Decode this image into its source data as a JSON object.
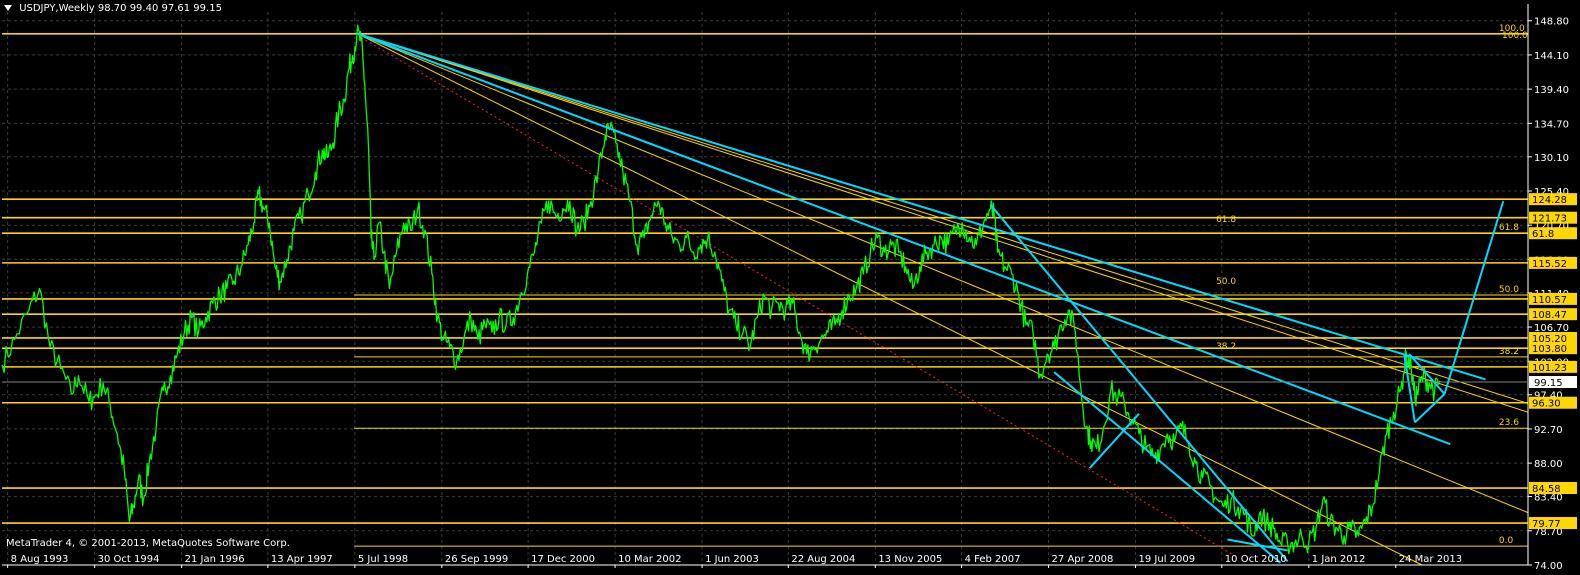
{
  "header": {
    "symbol_text": "USDJPY,Weekly",
    "ohlc_text": "98.70 99.40 97.61 99.15"
  },
  "footer": {
    "copyright": "MetaTrader 4, © 2001-2013, MetaQuotes Software Corp."
  },
  "colors": {
    "background": "#000000",
    "grid": "#3a3a3a",
    "price_line": "#00ff00",
    "level_line": "#ffd700",
    "trend_cyan": "#00d8ff",
    "dotted_red": "#ff2020",
    "axis_text": "#ffffff"
  },
  "chart_data": {
    "type": "line",
    "instrument": "USDJPY",
    "timeframe": "Weekly",
    "current_price": 99.15,
    "ylim": [
      74.0,
      150.0
    ],
    "y_tick_labels": [
      "148.80",
      "144.10",
      "139.40",
      "134.70",
      "130.10",
      "125.40",
      "120.70",
      "116.00",
      "111.40",
      "106.70",
      "102.00",
      "97.40",
      "92.70",
      "88.00",
      "83.40",
      "78.70",
      "74.00"
    ],
    "y_tick_values": [
      148.8,
      144.1,
      139.4,
      134.7,
      130.1,
      125.4,
      120.7,
      116.0,
      111.4,
      106.7,
      102.0,
      97.4,
      92.7,
      88.0,
      83.4,
      78.7,
      74.0
    ],
    "x_tick_labels": [
      "8 Aug 1993",
      "30 Oct 1994",
      "21 Jan 1996",
      "13 Apr 1997",
      "5 Jul 1998",
      "26 Sep 1999",
      "17 Dec 2000",
      "10 Mar 2002",
      "1 Jun 2003",
      "22 Aug 2004",
      "13 Nov 2005",
      "4 Feb 2007",
      "27 Apr 2008",
      "19 Jul 2009",
      "10 Oct 2010",
      "1 Jan 2012",
      "24 Mar 2013"
    ],
    "x_tick_values": [
      1993.6,
      1994.83,
      1996.06,
      1997.28,
      1998.51,
      1999.74,
      2000.96,
      2002.19,
      2003.42,
      2004.64,
      2005.87,
      2007.09,
      2008.32,
      2009.55,
      2010.77,
      2012.0,
      2013.23
    ],
    "xlim": [
      1993.52,
      2015.1
    ],
    "price_series": [
      [
        1993.52,
        101.5
      ],
      [
        1993.7,
        105
      ],
      [
        1993.9,
        109
      ],
      [
        1994.05,
        112
      ],
      [
        1994.2,
        104
      ],
      [
        1994.35,
        101
      ],
      [
        1994.5,
        97.5
      ],
      [
        1994.6,
        100
      ],
      [
        1994.75,
        96.5
      ],
      [
        1994.82,
        97
      ],
      [
        1994.95,
        99
      ],
      [
        1995.05,
        96
      ],
      [
        1995.15,
        92
      ],
      [
        1995.25,
        87
      ],
      [
        1995.32,
        80
      ],
      [
        1995.38,
        82
      ],
      [
        1995.45,
        86
      ],
      [
        1995.52,
        83
      ],
      [
        1995.6,
        88
      ],
      [
        1995.7,
        93
      ],
      [
        1995.8,
        98
      ],
      [
        1995.9,
        100
      ],
      [
        1996.0,
        103
      ],
      [
        1996.1,
        106
      ],
      [
        1996.2,
        108
      ],
      [
        1996.3,
        106
      ],
      [
        1996.4,
        108
      ],
      [
        1996.5,
        110
      ],
      [
        1996.6,
        111
      ],
      [
        1996.7,
        112
      ],
      [
        1996.8,
        113
      ],
      [
        1996.9,
        115
      ],
      [
        1997.0,
        118
      ],
      [
        1997.08,
        121
      ],
      [
        1997.15,
        125
      ],
      [
        1997.22,
        123
      ],
      [
        1997.3,
        121
      ],
      [
        1997.38,
        115
      ],
      [
        1997.45,
        113
      ],
      [
        1997.55,
        116
      ],
      [
        1997.65,
        120
      ],
      [
        1997.75,
        122
      ],
      [
        1997.85,
        125
      ],
      [
        1997.95,
        128
      ],
      [
        1998.05,
        131
      ],
      [
        1998.12,
        130
      ],
      [
        1998.2,
        132
      ],
      [
        1998.28,
        136
      ],
      [
        1998.36,
        138
      ],
      [
        1998.42,
        142
      ],
      [
        1998.48,
        144
      ],
      [
        1998.54,
        147
      ],
      [
        1998.6,
        146
      ],
      [
        1998.65,
        140
      ],
      [
        1998.7,
        132
      ],
      [
        1998.74,
        119
      ],
      [
        1998.78,
        116
      ],
      [
        1998.85,
        121
      ],
      [
        1998.92,
        117
      ],
      [
        1999.0,
        112
      ],
      [
        1999.1,
        117
      ],
      [
        1999.2,
        121
      ],
      [
        1999.3,
        120
      ],
      [
        1999.4,
        123
      ],
      [
        1999.5,
        120
      ],
      [
        1999.6,
        114
      ],
      [
        1999.68,
        108
      ],
      [
        1999.76,
        105
      ],
      [
        1999.85,
        104
      ],
      [
        1999.95,
        102
      ],
      [
        2000.05,
        105
      ],
      [
        2000.15,
        108
      ],
      [
        2000.25,
        105
      ],
      [
        2000.35,
        107
      ],
      [
        2000.45,
        106
      ],
      [
        2000.55,
        108
      ],
      [
        2000.65,
        107
      ],
      [
        2000.75,
        108
      ],
      [
        2000.85,
        111
      ],
      [
        2000.95,
        114
      ],
      [
        2001.05,
        117
      ],
      [
        2001.15,
        121
      ],
      [
        2001.25,
        124
      ],
      [
        2001.35,
        122
      ],
      [
        2001.45,
        123
      ],
      [
        2001.55,
        124
      ],
      [
        2001.65,
        120
      ],
      [
        2001.75,
        121
      ],
      [
        2001.85,
        124
      ],
      [
        2001.95,
        128
      ],
      [
        2002.05,
        133
      ],
      [
        2002.12,
        134
      ],
      [
        2002.2,
        132
      ],
      [
        2002.3,
        128
      ],
      [
        2002.4,
        124
      ],
      [
        2002.5,
        118
      ],
      [
        2002.6,
        119
      ],
      [
        2002.7,
        122
      ],
      [
        2002.8,
        124
      ],
      [
        2002.9,
        121
      ],
      [
        2003.0,
        119
      ],
      [
        2003.1,
        118
      ],
      [
        2003.2,
        119
      ],
      [
        2003.3,
        117
      ],
      [
        2003.4,
        118
      ],
      [
        2003.5,
        119
      ],
      [
        2003.6,
        117
      ],
      [
        2003.7,
        113
      ],
      [
        2003.8,
        109
      ],
      [
        2003.9,
        107
      ],
      [
        2004.0,
        106
      ],
      [
        2004.1,
        104
      ],
      [
        2004.2,
        108
      ],
      [
        2004.3,
        111
      ],
      [
        2004.4,
        109
      ],
      [
        2004.5,
        110
      ],
      [
        2004.6,
        109
      ],
      [
        2004.7,
        110
      ],
      [
        2004.8,
        106
      ],
      [
        2004.9,
        103
      ],
      [
        2005.0,
        104
      ],
      [
        2005.1,
        105
      ],
      [
        2005.2,
        106
      ],
      [
        2005.3,
        107
      ],
      [
        2005.4,
        109
      ],
      [
        2005.5,
        111
      ],
      [
        2005.6,
        112
      ],
      [
        2005.7,
        114
      ],
      [
        2005.8,
        117
      ],
      [
        2005.9,
        119
      ],
      [
        2006.0,
        117
      ],
      [
        2006.1,
        118
      ],
      [
        2006.2,
        117
      ],
      [
        2006.3,
        115
      ],
      [
        2006.4,
        112
      ],
      [
        2006.5,
        115
      ],
      [
        2006.6,
        117
      ],
      [
        2006.7,
        118
      ],
      [
        2006.8,
        119
      ],
      [
        2006.9,
        118
      ],
      [
        2007.0,
        120
      ],
      [
        2007.1,
        121
      ],
      [
        2007.2,
        119
      ],
      [
        2007.3,
        118
      ],
      [
        2007.4,
        121
      ],
      [
        2007.5,
        123
      ],
      [
        2007.55,
        122
      ],
      [
        2007.6,
        117
      ],
      [
        2007.7,
        115
      ],
      [
        2007.8,
        114
      ],
      [
        2007.9,
        111
      ],
      [
        2008.0,
        107
      ],
      [
        2008.1,
        106
      ],
      [
        2008.2,
        100
      ],
      [
        2008.3,
        103
      ],
      [
        2008.4,
        104
      ],
      [
        2008.5,
        107
      ],
      [
        2008.6,
        109
      ],
      [
        2008.7,
        106
      ],
      [
        2008.78,
        98
      ],
      [
        2008.85,
        93
      ],
      [
        2008.92,
        91
      ],
      [
        2009.0,
        90
      ],
      [
        2009.1,
        93
      ],
      [
        2009.2,
        98
      ],
      [
        2009.3,
        97
      ],
      [
        2009.4,
        96
      ],
      [
        2009.5,
        94
      ],
      [
        2009.6,
        92
      ],
      [
        2009.7,
        90
      ],
      [
        2009.8,
        89
      ],
      [
        2009.9,
        90
      ],
      [
        2010.0,
        92
      ],
      [
        2010.1,
        91
      ],
      [
        2010.2,
        93
      ],
      [
        2010.3,
        91
      ],
      [
        2010.4,
        88
      ],
      [
        2010.5,
        86
      ],
      [
        2010.6,
        85
      ],
      [
        2010.7,
        83
      ],
      [
        2010.8,
        82
      ],
      [
        2010.9,
        83
      ],
      [
        2011.0,
        82
      ],
      [
        2011.1,
        81
      ],
      [
        2011.2,
        78
      ],
      [
        2011.3,
        81
      ],
      [
        2011.4,
        80
      ],
      [
        2011.5,
        79
      ],
      [
        2011.6,
        77
      ],
      [
        2011.7,
        77
      ],
      [
        2011.8,
        77
      ],
      [
        2011.9,
        78
      ],
      [
        2012.0,
        77
      ],
      [
        2012.1,
        79
      ],
      [
        2012.2,
        83
      ],
      [
        2012.3,
        80
      ],
      [
        2012.4,
        79
      ],
      [
        2012.5,
        78
      ],
      [
        2012.6,
        79
      ],
      [
        2012.7,
        78
      ],
      [
        2012.8,
        80
      ],
      [
        2012.9,
        82
      ],
      [
        2013.0,
        87
      ],
      [
        2013.1,
        92
      ],
      [
        2013.2,
        95
      ],
      [
        2013.3,
        98
      ],
      [
        2013.38,
        103
      ],
      [
        2013.45,
        101
      ],
      [
        2013.5,
        97
      ],
      [
        2013.55,
        98
      ],
      [
        2013.62,
        100
      ],
      [
        2013.7,
        99
      ],
      [
        2013.78,
        98
      ],
      [
        2013.86,
        99.15
      ]
    ],
    "horizontal_levels": [
      {
        "value": 147.0,
        "label": "100.0"
      },
      {
        "value": 124.28,
        "label": "124.28"
      },
      {
        "value": 121.73,
        "label": "121.73"
      },
      {
        "value": 119.6,
        "label": "61.8"
      },
      {
        "value": 115.52,
        "label": "115.52"
      },
      {
        "value": 110.57,
        "label": "110.57"
      },
      {
        "value": 108.47,
        "label": "108.47"
      },
      {
        "value": 105.2,
        "label": "105.20"
      },
      {
        "value": 103.8,
        "label": "103.80"
      },
      {
        "value": 101.23,
        "label": "101.23"
      },
      {
        "value": 96.3,
        "label": "96.30"
      },
      {
        "value": 84.58,
        "label": "84.58"
      },
      {
        "value": 79.77,
        "label": "79.77"
      }
    ],
    "fib_labels": [
      {
        "label": "100.0",
        "value": 147.0,
        "x": 2015.0
      },
      {
        "label": "61.8",
        "value": 119.6,
        "x": 2015.0
      },
      {
        "label": "50.0",
        "value": 111.1,
        "x": 2015.0
      },
      {
        "label": "38.2",
        "value": 102.6,
        "x": 2015.0
      },
      {
        "label": "23.6",
        "value": 92.8,
        "x": 2015.0
      },
      {
        "label": "0.0",
        "value": 76.6,
        "x": 2015.0
      },
      {
        "label": "61.8",
        "value": 120.7,
        "x": 2011.0
      },
      {
        "label": "50.0",
        "value": 112.2,
        "x": 2011.0
      },
      {
        "label": "38.2",
        "value": 103.3,
        "x": 2011.0
      }
    ],
    "fib_short_levels": [
      {
        "value": 111.1,
        "x0": 1998.5,
        "x1": 2015.1
      },
      {
        "value": 102.6,
        "x0": 1998.5,
        "x1": 2015.1
      },
      {
        "value": 92.8,
        "x0": 1998.5,
        "x1": 2015.1
      },
      {
        "value": 76.6,
        "x0": 1998.5,
        "x1": 2015.1
      }
    ],
    "fan_lines": [
      {
        "x0": 1998.55,
        "y0": 147.0,
        "x1": 2015.1,
        "y1": 96.2
      },
      {
        "x0": 1998.55,
        "y0": 147.0,
        "x1": 2015.1,
        "y1": 81.2
      },
      {
        "x0": 1998.55,
        "y0": 147.0,
        "x1": 2013.6,
        "y1": 74.0
      },
      {
        "x0": 1998.55,
        "y0": 147.0,
        "x1": 2015.1,
        "y1": 95.0
      }
    ],
    "cyan_lines": [
      {
        "x0": 1998.55,
        "y0": 147.0,
        "x1": 2014.5,
        "y1": 99.5
      },
      {
        "x0": 1998.55,
        "y0": 147.0,
        "x1": 2014.0,
        "y1": 90.6
      },
      {
        "x0": 2007.5,
        "y0": 123.5,
        "x1": 2011.7,
        "y1": 74.5
      },
      {
        "x0": 2008.4,
        "y0": 100.5,
        "x1": 2011.6,
        "y1": 74.3
      },
      {
        "x0": 2008.9,
        "y0": 87.3,
        "x1": 2009.6,
        "y1": 94.8
      },
      {
        "x0": 2010.85,
        "y0": 77.5,
        "x1": 2011.7,
        "y1": 76.0
      },
      {
        "x0": 2013.35,
        "y0": 103.0,
        "x1": 2013.5,
        "y1": 93.6
      },
      {
        "x0": 2013.42,
        "y0": 103.0,
        "x1": 2013.92,
        "y1": 97.5
      },
      {
        "x0": 2013.5,
        "y0": 93.6,
        "x1": 2013.92,
        "y1": 97.5
      },
      {
        "x0": 2013.92,
        "y0": 97.5,
        "x1": 2014.75,
        "y1": 124.0
      }
    ],
    "dotted_line": {
      "x0": 1998.6,
      "y0": 146.5,
      "x1": 2011.0,
      "y1": 75.0
    }
  }
}
